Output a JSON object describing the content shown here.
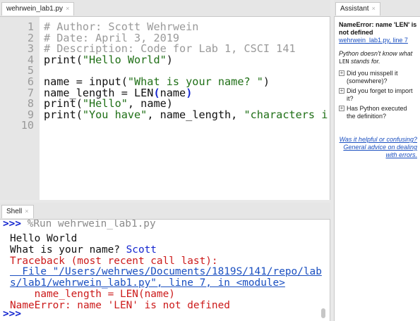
{
  "editor": {
    "tab_label": "wehrwein_lab1.py",
    "line_numbers": [
      "1",
      "2",
      "3",
      "4",
      "5",
      "6",
      "7",
      "8",
      "9",
      "10"
    ]
  },
  "code": {
    "l1": "# Author: Scott Wehrwein",
    "l2": "# Date: April 3, 2019",
    "l3": "# Description: Code for Lab 1, CSCI 141",
    "l4a": "print(",
    "l4b": "\"Hello World\"",
    "l4c": ")",
    "l6a": "name = input(",
    "l6b": "\"What is your name? \"",
    "l6c": ")",
    "l7a": "name_length = LEN",
    "l7b": "(",
    "l7c": "name",
    "l7d": ")",
    "l8a": "print(",
    "l8b": "\"Hello\"",
    "l8c": ", name)",
    "l9a": "print(",
    "l9b": "\"You have\"",
    "l9c": ", name_length, ",
    "l9d": "\"characters i"
  },
  "shell": {
    "tab_label": "Shell",
    "prompt": ">>>",
    "run_command": "%Run wehrwein_lab1.py",
    "out1": "Hello World",
    "out2_prefix": "What is your name? ",
    "out2_input": "Scott",
    "tb1": "Traceback (most recent call last):",
    "tb2": "  File \"/Users/wehrwes/Documents/1819S/141/repo/lab",
    "tb3": "s/lab1/wehrwein_lab1.py\", line 7, in <module>",
    "tb4": "    name_length = LEN(name)",
    "tb5": "NameError: name 'LEN' is not defined"
  },
  "assistant": {
    "tab_label": "Assistant",
    "title": "NameError: name 'LEN' is not defined",
    "location": "wehrwein_lab1.py, line 7",
    "note_pre": "Python doesn't know what ",
    "note_code": "LEN",
    "note_post": " stands for.",
    "items": [
      "Did you misspell it (somewhere)?",
      "Did you forget to import it?",
      "Has Python executed the definition?"
    ],
    "feedback_link": "Was it helpful or confusing?",
    "advice_link": "General advice on dealing with errors."
  }
}
